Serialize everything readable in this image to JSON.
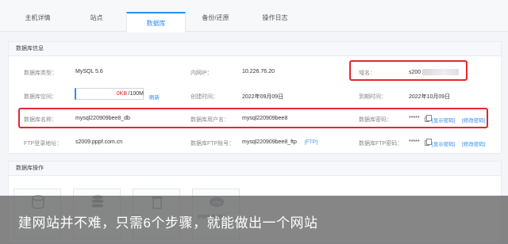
{
  "tabs": [
    {
      "label": "主机详情"
    },
    {
      "label": "站点"
    },
    {
      "label": "数据库"
    },
    {
      "label": "备份/还原"
    },
    {
      "label": "操作日志"
    }
  ],
  "db_info": {
    "section_title": "数据库信息",
    "type_label": "数据库类型：",
    "type_value": "MySQL 5.6",
    "internal_ip_label": "内网IP：",
    "internal_ip_value": "10.226.76.20",
    "domain_label": "域名：",
    "domain_value": "s200",
    "space_label": "数据库空间：",
    "space_used": "0KB",
    "space_total": "/100M",
    "refresh_link": "刷新",
    "created_label": "创建时间：",
    "created_value": "2022年09月09日",
    "expire_label": "到期时间：",
    "expire_value": "2022年10月09日",
    "name_label": "数据库名称：",
    "name_value": "mysql220909bee8_db",
    "user_label": "数据库用户名：",
    "user_value": "mysql220909bee8",
    "password_label": "数据库密码：",
    "password_value": "*****",
    "show_password_link": "[显示密码]",
    "change_password_link": "[修改密码]",
    "ftp_address_label": "FTP登录地址：",
    "ftp_address_value": "s2009.pppf.com.cn",
    "ftp_account_label": "数据库FTP账号：",
    "ftp_account_value": "mysql220909bee8_ftp",
    "ftp_link": "[FTP]",
    "ftp_password_label": "数据库FTP密码：",
    "ftp_password_value": "*****",
    "ftp_show_password_link": "[显示密码]",
    "ftp_change_password_link": "[修改密码]"
  },
  "db_ops": {
    "section_title": "数据库操作",
    "card_icon_text": "php",
    "card_caption": "phpMyAdmin"
  },
  "overlay": {
    "caption": "建网站并不难，只需6个步骤，就能做出一个网站"
  },
  "colors": {
    "accent": "#2d8cf0",
    "highlight": "#e4272d",
    "used_space": "#e8211a"
  }
}
